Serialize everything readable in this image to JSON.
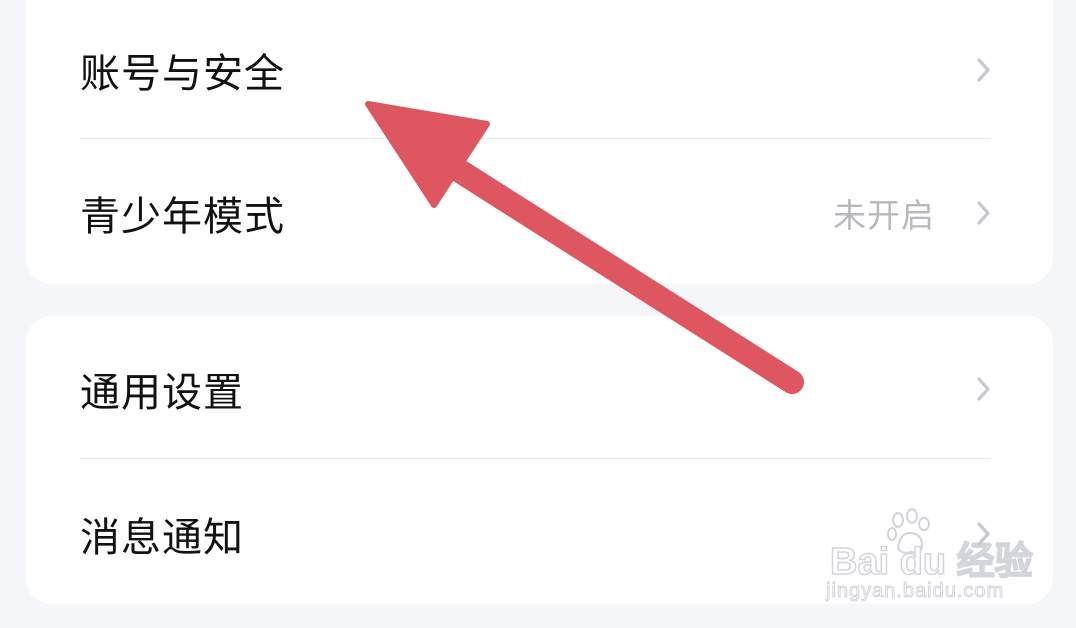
{
  "settings_group_1": {
    "items": [
      {
        "label": "账号与安全",
        "value": ""
      },
      {
        "label": "青少年模式",
        "value": "未开启"
      }
    ]
  },
  "settings_group_2": {
    "items": [
      {
        "label": "通用设置",
        "value": ""
      },
      {
        "label": "消息通知",
        "value": ""
      }
    ]
  },
  "annotation": {
    "arrow_color": "#dd5660"
  },
  "watermark": {
    "brand": "Bai du 经验",
    "url": "jingyan.baidu.com"
  },
  "colors": {
    "background": "#f5f6fa",
    "card": "#ffffff",
    "label_text": "#111111",
    "value_text": "#b7b9bf",
    "chevron": "#c7c9ce"
  }
}
